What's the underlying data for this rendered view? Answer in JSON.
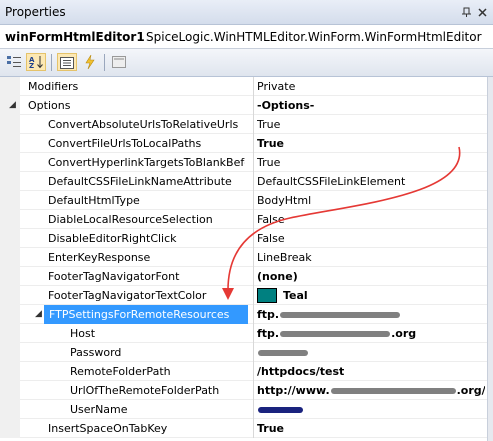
{
  "window": {
    "title": "Properties",
    "controls": [
      "pin-icon",
      "close-icon"
    ]
  },
  "object_selector": {
    "name": "winFormHtmlEditor1",
    "type": "SpiceLogic.WinHTMLEditor.WinForm.WinFormHtmlEditor"
  },
  "toolbar": {
    "buttons": [
      "categorized-icon",
      "alphabetical-icon",
      "properties-icon",
      "events-icon",
      "property-pages-icon"
    ]
  },
  "grid": {
    "rows": [
      {
        "name": "Modifiers",
        "value": "Private",
        "level": 0,
        "bold_value": false
      },
      {
        "name": "Options",
        "value": "-Options-",
        "level": 0,
        "bold_value": true,
        "expander": "◢"
      },
      {
        "name": "ConvertAbsoluteUrlsToRelativeUrls",
        "value": "True",
        "level": 1,
        "bold_value": false
      },
      {
        "name": "ConvertFileUrlsToLocalPaths",
        "value": "True",
        "level": 1,
        "bold_value": true
      },
      {
        "name": "ConvertHyperlinkTargetsToBlankBefor",
        "value": "True",
        "level": 1,
        "bold_value": false
      },
      {
        "name": "DefaultCSSFileLinkNameAttribute",
        "value": "DefaultCSSFileLinkElement",
        "level": 1,
        "bold_value": false
      },
      {
        "name": "DefaultHtmlType",
        "value": "BodyHtml",
        "level": 1,
        "bold_value": false
      },
      {
        "name": "DiableLocalResourceSelection",
        "value": "False",
        "level": 1,
        "bold_value": false
      },
      {
        "name": "DisableEditorRightClick",
        "value": "False",
        "level": 1,
        "bold_value": false
      },
      {
        "name": "EnterKeyResponse",
        "value": "LineBreak",
        "level": 1,
        "bold_value": false
      },
      {
        "name": "FooterTagNavigatorFont",
        "value": "(none)",
        "level": 1,
        "bold_value": true
      },
      {
        "name": "FooterTagNavigatorTextColor",
        "value": "Teal",
        "level": 1,
        "bold_value": true,
        "swatch": "#008080"
      },
      {
        "name": "FTPSettingsForRemoteResources",
        "value": "ftp.",
        "level": 1,
        "bold_value": true,
        "selected": true,
        "expander": "◢",
        "redacted": true
      },
      {
        "name": "Host",
        "value": "ftp.",
        "value_suffix": ".org",
        "level": 2,
        "bold_value": true,
        "redacted": true
      },
      {
        "name": "Password",
        "value": "",
        "level": 2,
        "bold_value": true,
        "redacted": true
      },
      {
        "name": "RemoteFolderPath",
        "value": "/httpdocs/test",
        "level": 2,
        "bold_value": true
      },
      {
        "name": "UrlOfTheRemoteFolderPath",
        "value": "http://www.",
        "value_suffix": ".org/test",
        "level": 2,
        "bold_value": true,
        "redacted": true
      },
      {
        "name": "UserName",
        "value": "",
        "level": 2,
        "bold_value": true,
        "redacted": true,
        "redact_color": "#1a237e"
      },
      {
        "name": "InsertSpaceOnTabKey",
        "value": "True",
        "level": 1,
        "bold_value": true
      }
    ]
  },
  "annotation": {
    "arrow_color": "#e53935"
  }
}
